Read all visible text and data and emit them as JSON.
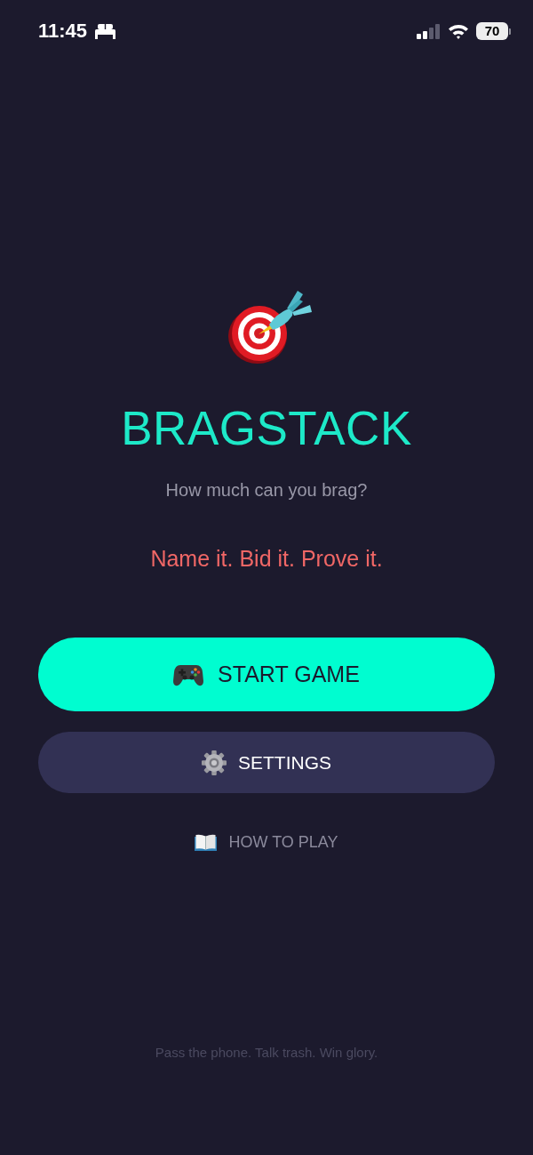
{
  "status_bar": {
    "time": "11:45",
    "battery": "70"
  },
  "app": {
    "title": "BRAGSTACK",
    "subtitle": "How much can you brag?",
    "tagline": "Name it. Bid it. Prove it."
  },
  "buttons": [
    {
      "kind": "primary",
      "label": "START GAME"
    },
    {
      "kind": "secondary",
      "label": "SETTINGS"
    },
    {
      "kind": "link",
      "label": "HOW TO PLAY"
    }
  ],
  "footer": "Pass the phone. Talk trash. Win glory."
}
